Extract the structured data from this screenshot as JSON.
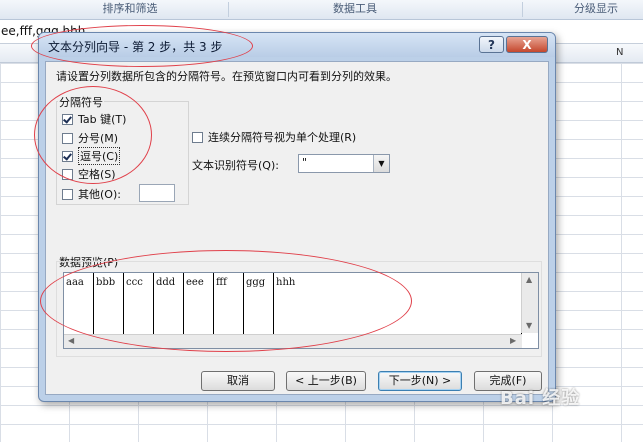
{
  "excel": {
    "ribbon_groups": [
      "排序和筛选",
      "数据工具",
      "分级显示"
    ],
    "formula_text": "ee,fff,ggg,hhh",
    "column_label": "N"
  },
  "dialog": {
    "title": "文本分列向导 - 第 2 步，共 3 步",
    "help_label": "?",
    "close_label": "X",
    "description": "请设置分列数据所包含的分隔符号。在预览窗口内可看到分列的效果。",
    "delimiters": {
      "label": "分隔符号",
      "items": [
        {
          "label": "Tab 键(T)",
          "checked": true
        },
        {
          "label": "分号(M)",
          "checked": false
        },
        {
          "label": "逗号(C)",
          "checked": true
        },
        {
          "label": "空格(S)",
          "checked": false
        },
        {
          "label": "其他(O):",
          "checked": false
        }
      ],
      "other_value": ""
    },
    "consecutive": {
      "label": "连续分隔符号视为单个处理(R)",
      "checked": false
    },
    "text_qualifier": {
      "label": "文本识别符号(Q):",
      "value": "\""
    },
    "preview": {
      "label": "数据预览(P)",
      "cells": [
        "aaa",
        "bbb",
        "ccc",
        "ddd",
        "eee",
        "fff",
        "ggg",
        "hhh"
      ]
    },
    "buttons": {
      "cancel": "取消",
      "back": "< 上一步(B)",
      "next": "下一步(N) >",
      "finish": "完成(F)"
    }
  },
  "watermark": "Bai 经验",
  "colors": {
    "annotation": "#e0404a",
    "dialog_frame": "#bcd0e8",
    "client_bg": "#f0f0f0"
  }
}
